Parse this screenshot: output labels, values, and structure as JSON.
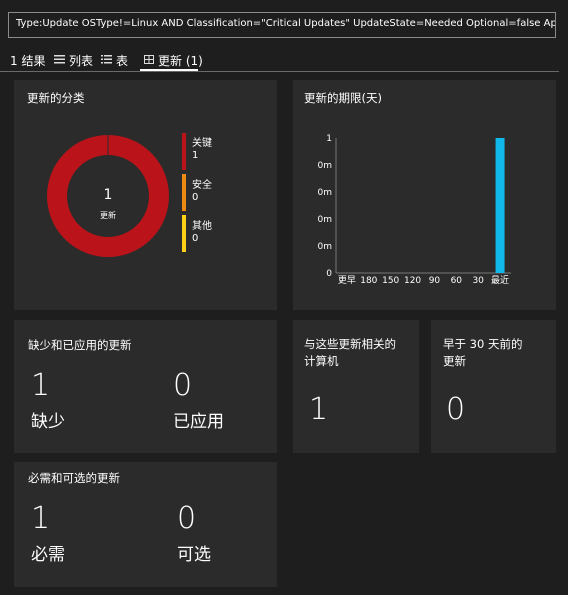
{
  "query": "Type:Update OSType!=Linux AND Classification=\"Critical Updates\" UpdateState=Needed Optional=false Approved!=false",
  "tabs": [
    {
      "label": "1 结果",
      "icon": ""
    },
    {
      "label": "列表",
      "icon": "list-icon"
    },
    {
      "label": "表",
      "icon": "table-icon"
    },
    {
      "label": "更新 (1)",
      "icon": "grid-icon"
    }
  ],
  "classification": {
    "title": "更新的分类",
    "total": "1",
    "total_label": "更新",
    "legend": [
      {
        "label": "关键",
        "value": "1",
        "color": "#ba141a"
      },
      {
        "label": "安全",
        "value": "0",
        "color": "#ec8a12"
      },
      {
        "label": "其他",
        "value": "0",
        "color": "#fcd116"
      }
    ]
  },
  "chart_data": {
    "type": "bar",
    "title": "更新的期限(天)",
    "categories": [
      "更早",
      "180",
      "150",
      "120",
      "90",
      "60",
      "30",
      "最近"
    ],
    "values": [
      0,
      0,
      0,
      0,
      0,
      0,
      0,
      1
    ],
    "ylim": [
      0,
      1
    ],
    "ytick_labels": [
      "0",
      "0m",
      "0m",
      "0m",
      "0m",
      "1"
    ],
    "color": "#10b9ea"
  },
  "missing": {
    "title": "缺少和已应用的更新",
    "missing_value": "1",
    "missing_label": "缺少",
    "applied_value": "0",
    "applied_label": "已应用"
  },
  "computers": {
    "title_line1": "与这些更新相关的",
    "title_line2": "计算机",
    "value": "1"
  },
  "older": {
    "title_line1": "早于 30 天前的",
    "title_line2": "更新",
    "value": "0"
  },
  "required": {
    "title": "必需和可选的更新",
    "required_value": "1",
    "required_label": "必需",
    "optional_value": "0",
    "optional_label": "可选"
  }
}
